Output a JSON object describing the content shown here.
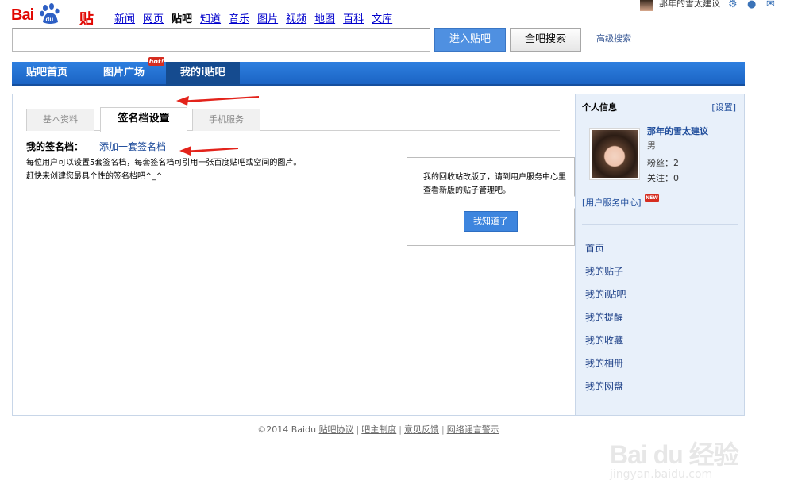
{
  "header": {
    "logo_text_bai": "Bai",
    "logo_text_tieba": "贴吧",
    "nav": [
      "新闻",
      "网页",
      "贴吧",
      "知道",
      "音乐",
      "图片",
      "视频",
      "地图",
      "百科",
      "文库"
    ],
    "current_nav_index": 2,
    "username": "那年的雪太建议",
    "search_placeholder": "",
    "enter_button": "进入贴吧",
    "all_search_button": "全吧搜索",
    "advanced_search": "高级搜索"
  },
  "navbar": {
    "items": [
      "贴吧首页",
      "图片广场",
      "我的i贴吧"
    ],
    "hot_badge": "hot!",
    "active_index": 2
  },
  "tabs": [
    "基本资料",
    "签名档设置",
    "手机服务"
  ],
  "signature": {
    "label": "我的签名档：",
    "add_link": "添加一套签名档",
    "description_line1": "每位用户可以设置5套签名档，每套签名档可引用一张百度贴吧或空间的图片。",
    "description_line2": "赶快来创建您最具个性的签名档吧^_^"
  },
  "popup": {
    "text": "我的回收站改版了，请到用户服务中心里查看新版的贴子管理吧。",
    "button": "我知道了"
  },
  "sidebar": {
    "title": "个人信息",
    "setting": "[设置]",
    "name": "那年的雪太建议",
    "gender": "男",
    "fans": "粉丝：2",
    "follow": "关注：0",
    "service_center": "[用户服务中心]",
    "new_badge": "NEW",
    "links": [
      "首页",
      "我的贴子",
      "我的i贴吧",
      "我的提醒",
      "我的收藏",
      "我的相册",
      "我的网盘"
    ]
  },
  "footer": {
    "copyright": "©2014 Baidu",
    "links": [
      "贴吧协议",
      "吧主制度",
      "意见反馈",
      "网络谣言警示"
    ]
  },
  "watermark": {
    "text": "Bai du 经验",
    "url": "jingyan.baidu.com"
  },
  "colors": {
    "nav_blue": "#1b64c4",
    "nav_active": "#154b8f",
    "link_blue": "#214e9c",
    "button_blue": "#4f90e1",
    "arrow_red": "#e3231b",
    "brand_red": "#e10601"
  }
}
